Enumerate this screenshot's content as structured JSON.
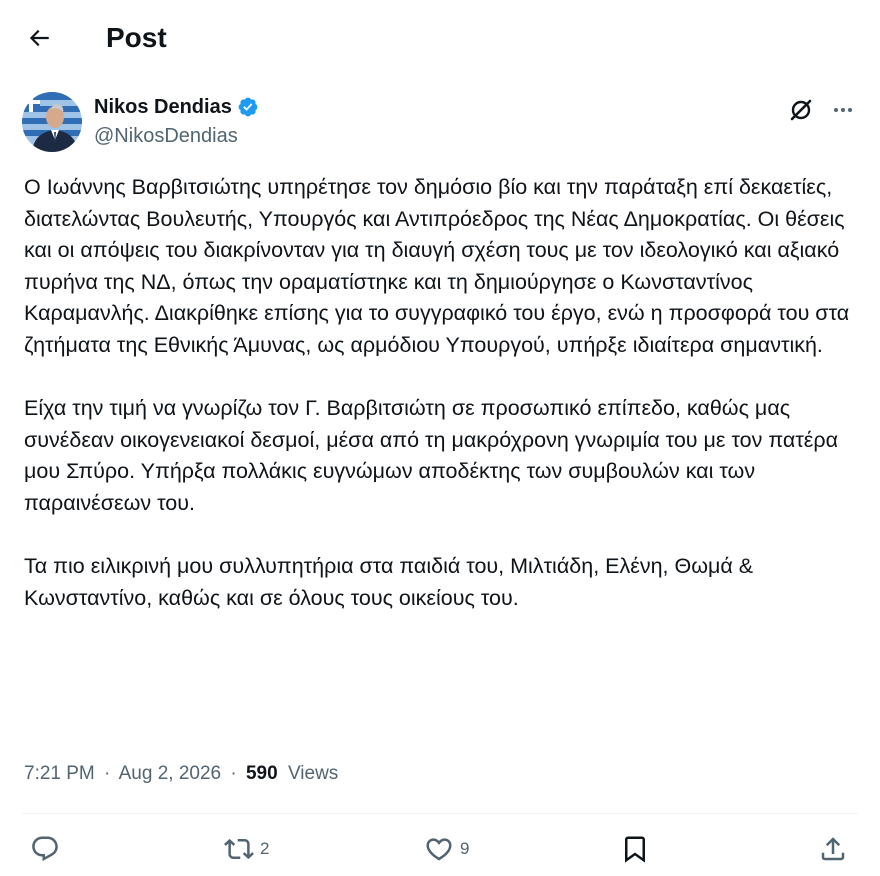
{
  "header": {
    "title": "Post",
    "back_icon": "arrow-left-icon"
  },
  "author": {
    "name": "Nikos Dendias",
    "handle": "@NikosDendias",
    "verified": true,
    "verified_color": "#1d9bf0"
  },
  "post": {
    "paragraphs": [
      "Ο Ιωάννης Βαρβιτσιώτης υπηρέτησε τον δημόσιο βίο και την παράταξη επί δεκαετίες, διατελώντας Βουλευτής, Υπουργός και Αντιπρόεδρος της Νέας Δημοκρατίας. Οι θέσεις και οι απόψεις του διακρίνονταν για τη διαυγή σχέση τους με τον ιδεολογικό και αξιακό πυρήνα της ΝΔ, όπως την οραματίστηκε και τη δημιούργησε ο Κωνσταντίνος Καραμανλής. Διακρίθηκε επίσης για το συγγραφικό του έργο, ενώ η προσφορά του στα ζητήματα της Εθνικής Άμυνας, ως αρμόδιου Υπουργού, υπήρξε ιδιαίτερα σημαντική.",
      "Είχα την τιμή να γνωρίζω τον Γ. Βαρβιτσιώτη σε προσωπικό επίπεδο, καθώς μας συνέδεαν οικογενειακοί δεσμοί, μέσα από τη μακρόχρονη γνωριμία του με τον πατέρα μου Σπύρο. Υπήρξα πολλάκις ευγνώμων αποδέκτης των συμβουλών και των παραινέσεων του.",
      "Τα πιο ειλικρινή μου συλλυπητήρια στα παιδιά του, Μιλτιάδη, Ελένη, Θωμά & Κωνσταντίνο, καθώς και σε όλους τους οικείους του."
    ],
    "time": "7:21 PM",
    "separator": "·",
    "date": "Aug 2, 2026",
    "views_count": "590",
    "views_label": "Views"
  },
  "actions": {
    "reply_icon": "reply-icon",
    "repost_icon": "repost-icon",
    "repost_count": "2",
    "like_icon": "heart-icon",
    "like_count": "9",
    "bookmark_icon": "bookmark-icon",
    "share_icon": "share-icon"
  },
  "colors": {
    "text": "#0f1419",
    "secondary": "#536471",
    "divider": "#eff3f4"
  }
}
